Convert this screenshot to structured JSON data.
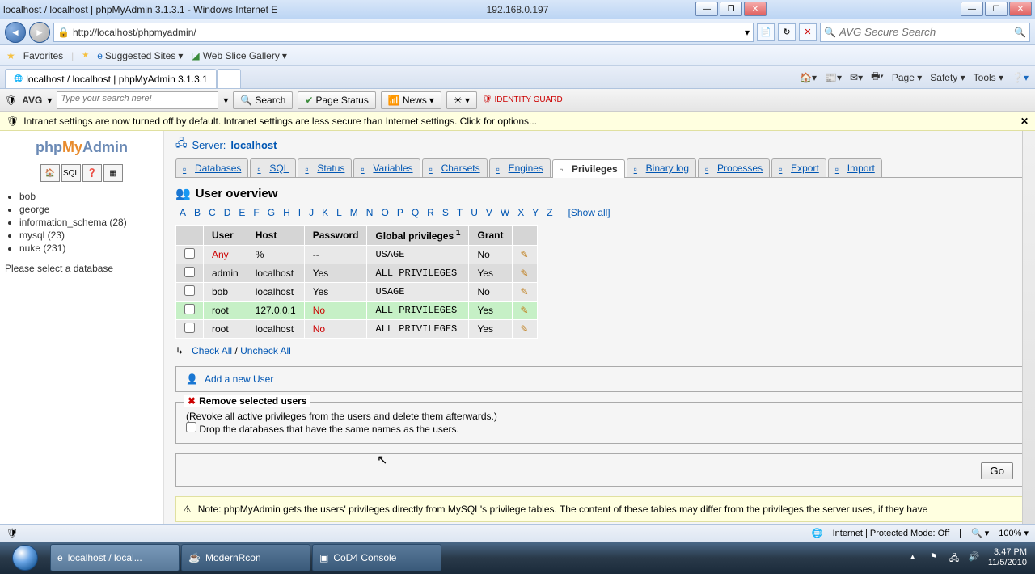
{
  "window": {
    "title": "localhost / localhost | phpMyAdmin 3.1.3.1 - Windows Internet E",
    "title_ip": "192.168.0.197"
  },
  "nav": {
    "url": "http://localhost/phpmyadmin/",
    "avg_placeholder": "AVG Secure Search"
  },
  "favorites": {
    "label": "Favorites",
    "suggested": "Suggested Sites",
    "slice": "Web Slice Gallery"
  },
  "tab": {
    "title": "localhost / localhost | phpMyAdmin 3.1.3.1"
  },
  "tabmenu": {
    "page": "Page",
    "safety": "Safety",
    "tools": "Tools"
  },
  "avgbar": {
    "logo": "AVG",
    "search_placeholder": "Type your search here!",
    "search_btn": "Search",
    "page_status": "Page Status",
    "news": "News",
    "guard": "IDENTITY GUARD"
  },
  "infobar": {
    "text": "Intranet settings are now turned off by default. Intranet settings are less secure than Internet settings. Click for options..."
  },
  "sidebar": {
    "logo": {
      "a": "php",
      "b": "My",
      "c": "Admin"
    },
    "dbs": [
      "bob",
      "george",
      "information_schema (28)",
      "mysql (23)",
      "nuke (231)"
    ],
    "select_msg": "Please select a database"
  },
  "server": {
    "label": "Server:",
    "name": "localhost",
    "tabs": [
      "Databases",
      "SQL",
      "Status",
      "Variables",
      "Charsets",
      "Engines",
      "Privileges",
      "Binary log",
      "Processes",
      "Export",
      "Import"
    ],
    "active_tab": 6
  },
  "section": {
    "heading": "User overview"
  },
  "alpha": {
    "letters": [
      "A",
      "B",
      "C",
      "D",
      "E",
      "F",
      "G",
      "H",
      "I",
      "J",
      "K",
      "L",
      "M",
      "N",
      "O",
      "P",
      "Q",
      "R",
      "S",
      "T",
      "U",
      "V",
      "W",
      "X",
      "Y",
      "Z"
    ],
    "showall": "[Show all]"
  },
  "table": {
    "headers": [
      "User",
      "Host",
      "Password",
      "Global privileges",
      "Grant"
    ],
    "sup": "1",
    "rows": [
      {
        "user": "Any",
        "host": "%",
        "password": "--",
        "priv": "USAGE",
        "grant": "No",
        "any": true
      },
      {
        "user": "admin",
        "host": "localhost",
        "password": "Yes",
        "priv": "ALL PRIVILEGES",
        "grant": "Yes"
      },
      {
        "user": "bob",
        "host": "localhost",
        "password": "Yes",
        "priv": "USAGE",
        "grant": "No"
      },
      {
        "user": "root",
        "host": "127.0.0.1",
        "password": "No",
        "priv": "ALL PRIVILEGES",
        "grant": "Yes",
        "nopass": true,
        "hl": true
      },
      {
        "user": "root",
        "host": "localhost",
        "password": "No",
        "priv": "ALL PRIVILEGES",
        "grant": "Yes",
        "nopass": true
      }
    ],
    "check_all": "Check All",
    "uncheck_all": "Uncheck All"
  },
  "adduser": {
    "label": "Add a new User"
  },
  "remove": {
    "legend": "Remove selected users",
    "desc": "(Revoke all active privileges from the users and delete them afterwards.)",
    "drop": "Drop the databases that have the same names as the users."
  },
  "go": "Go",
  "note": {
    "text": "Note: phpMyAdmin gets the users' privileges directly from MySQL's privilege tables. The content of these tables may differ from the privileges the server uses, if they have"
  },
  "status": {
    "mode": "Internet | Protected Mode: Off",
    "zoom": "100%"
  },
  "taskbar": {
    "items": [
      "localhost / local...",
      "ModernRcon",
      "CoD4 Console"
    ],
    "time": "3:47 PM",
    "date": "11/5/2010"
  }
}
